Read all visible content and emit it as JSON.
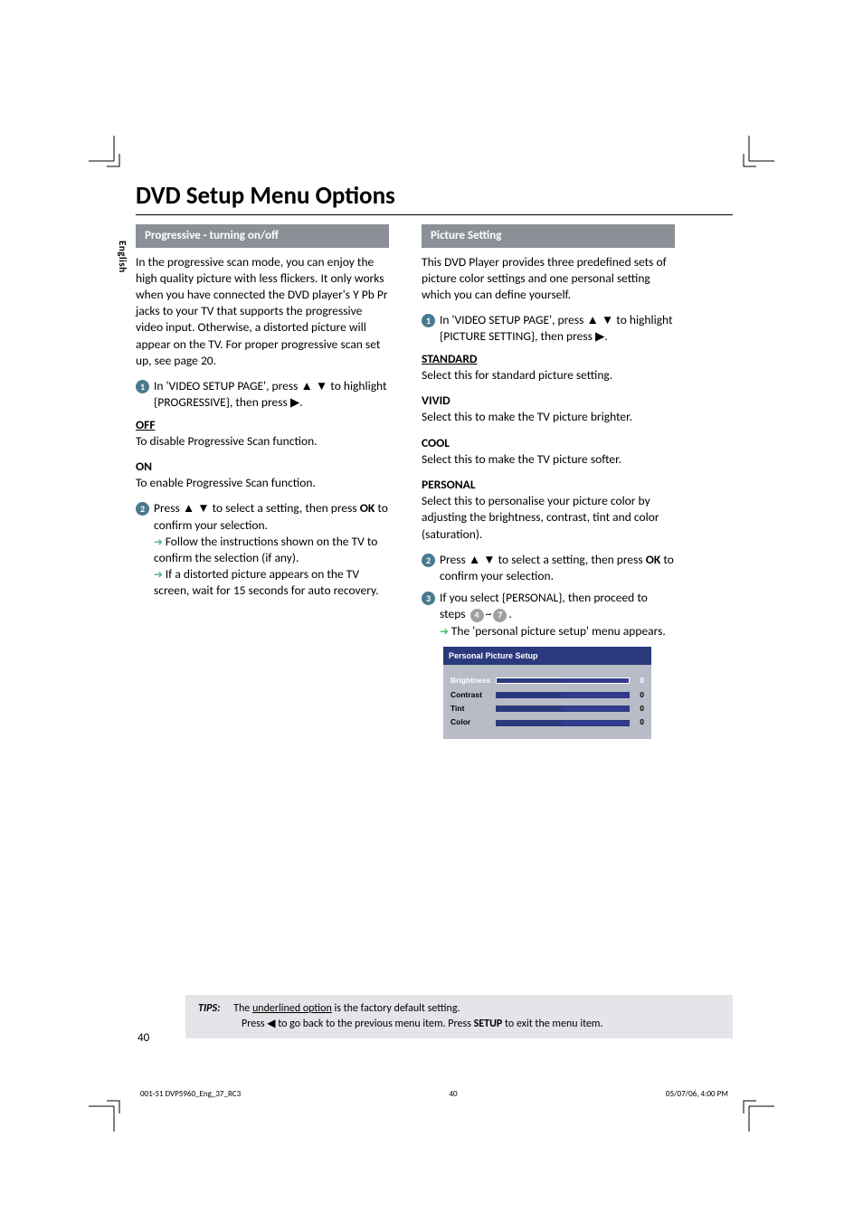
{
  "title": "DVD Setup Menu Options",
  "language_tab": "English",
  "left": {
    "bar": "Progressive - turning on/off",
    "intro": "In the progressive scan mode, you can enjoy the high quality picture with less flickers.  It only works when you have connected the DVD player's Y Pb Pr jacks to your TV that supports the progressive video input.  Otherwise, a distorted picture will appear on the TV.  For proper progressive scan set up, see page 20.",
    "step1": "In 'VIDEO SETUP PAGE', press ▲ ▼ to highlight {PROGRESSIVE}, then press ▶.",
    "off_head": "OFF",
    "off_body": "To disable Progressive Scan function.",
    "on_head": "ON",
    "on_body": "To enable Progressive Scan function.",
    "step2a": "Press ▲ ▼ to select a setting, then press ",
    "step2_ok": "OK",
    "step2b": " to confirm your selection.",
    "step2_sub1": "Follow the instructions shown on the TV to confirm the selection (if any).",
    "step2_sub2": "If a distorted picture appears on the TV screen, wait for 15 seconds for auto recovery."
  },
  "right": {
    "bar": "Picture Setting",
    "intro": "This DVD Player provides three predefined sets of picture color settings and one personal setting which you can define yourself.",
    "step1": "In 'VIDEO SETUP PAGE', press ▲ ▼ to highlight {PICTURE SETTING}, then press ▶.",
    "std_head": "STANDARD",
    "std_body": "Select this for standard picture setting.",
    "vivid_head": "VIVID",
    "vivid_body": "Select this to make the TV picture brighter.",
    "cool_head": "COOL",
    "cool_body": "Select this to make the TV picture softer.",
    "pers_head": "PERSONAL",
    "pers_body": "Select this to personalise your picture color by adjusting the brightness, contrast, tint and color (saturation).",
    "step2a": "Press ▲ ▼ to select a setting, then press ",
    "step2_ok": "OK",
    "step2b": " to confirm your selection.",
    "step3a": "If you select {PERSONAL}, then proceed to steps ",
    "step3b": "~",
    "step3c": ".",
    "step3_sub": "The 'personal picture setup' menu appears.",
    "osd_title": "Personal Picture Setup",
    "osd": {
      "brightness": {
        "label": "Brightness",
        "val": "0"
      },
      "contrast": {
        "label": "Contrast",
        "val": "0"
      },
      "tint": {
        "label": "Tint",
        "val": "0"
      },
      "color": {
        "label": "Color",
        "val": "0"
      }
    }
  },
  "tips": {
    "label": "TIPS:",
    "line1a": "The ",
    "line1b": "underlined option",
    "line1c": " is the factory default setting.",
    "line2a": "Press ◀ to go back to the previous menu item. Press ",
    "line2b": "SETUP",
    "line2c": " to exit the menu item."
  },
  "page_number": "40",
  "footer": {
    "left": "001-51 DVP5960_Eng_37_RC3",
    "mid": "40",
    "right": "05/07/06, 4:00 PM"
  }
}
